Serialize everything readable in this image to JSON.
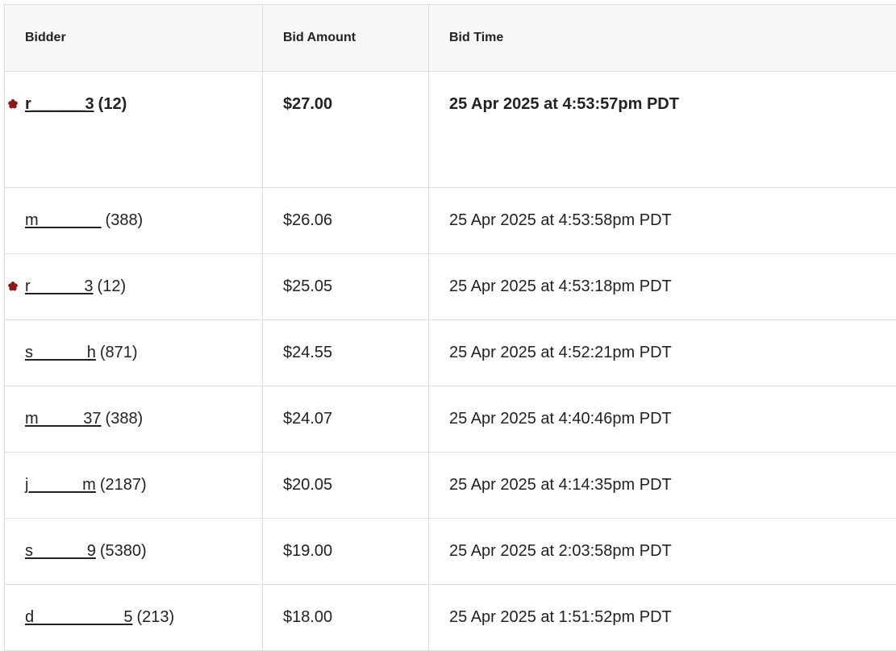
{
  "table": {
    "headers": {
      "bidder": "Bidder",
      "amount": "Bid Amount",
      "time": "Bid Time"
    },
    "rows": [
      {
        "bidder": "r______3",
        "feedback": "(12)",
        "amount": "$27.00",
        "time": "25 Apr 2025 at 4:53:57pm PDT",
        "winning": true,
        "icon": true
      },
      {
        "bidder": "m_______",
        "feedback": "(388)",
        "amount": "$26.06",
        "time": "25 Apr 2025 at 4:53:58pm PDT",
        "winning": false,
        "icon": false
      },
      {
        "bidder": "r______3",
        "feedback": "(12)",
        "amount": "$25.05",
        "time": "25 Apr 2025 at 4:53:18pm PDT",
        "winning": false,
        "icon": true
      },
      {
        "bidder": "s______h",
        "feedback": "(871)",
        "amount": "$24.55",
        "time": "25 Apr 2025 at 4:52:21pm PDT",
        "winning": false,
        "icon": false
      },
      {
        "bidder": "m_____37",
        "feedback": "(388)",
        "amount": "$24.07",
        "time": "25 Apr 2025 at 4:40:46pm PDT",
        "winning": false,
        "icon": false
      },
      {
        "bidder": "j______m",
        "feedback": "(2187)",
        "amount": "$20.05",
        "time": "25 Apr 2025 at 4:14:35pm PDT",
        "winning": false,
        "icon": false
      },
      {
        "bidder": "s______9",
        "feedback": "(5380)",
        "amount": "$19.00",
        "time": "25 Apr 2025 at 2:03:58pm PDT",
        "winning": false,
        "icon": false
      },
      {
        "bidder": "d__________5",
        "feedback": "(213)",
        "amount": "$18.00",
        "time": "25 Apr 2025 at 1:51:52pm PDT",
        "winning": false,
        "icon": false
      }
    ]
  },
  "icons": {
    "new_bidder": "flower-icon"
  },
  "colors": {
    "flower_icon": "#8b1a1a",
    "header_bg": "#f7f7f7",
    "border": "#dddddd"
  }
}
